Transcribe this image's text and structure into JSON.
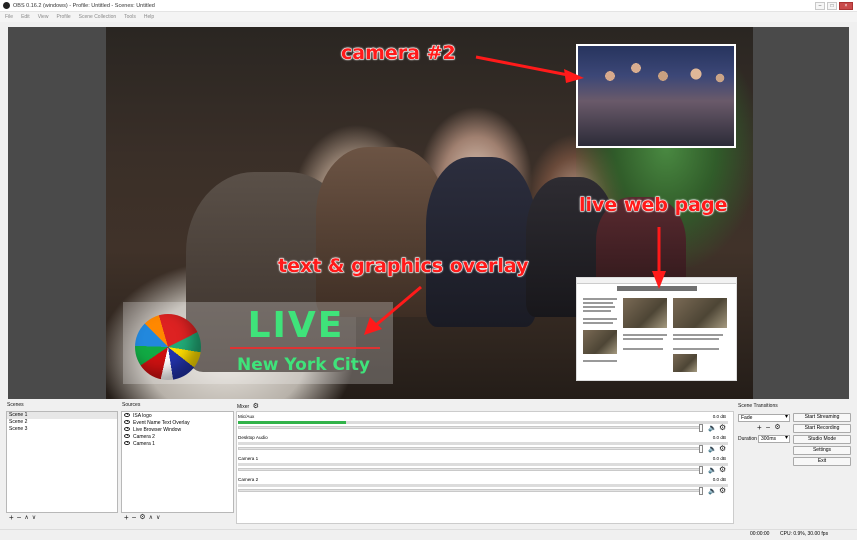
{
  "window": {
    "title": "OBS 0.16.2 (windows) - Profile: Untitled - Scenes: Untitled",
    "min_icon": "minimize-icon",
    "max_icon": "maximize-icon",
    "close_icon": "close-icon"
  },
  "menu": [
    "File",
    "Edit",
    "View",
    "Profile",
    "Scene Collection",
    "Tools",
    "Help"
  ],
  "preview": {
    "annotations": {
      "camera2": "camera #2",
      "webpage": "live web page",
      "overlay": "text & graphics overlay"
    },
    "overlay_live": "LIVE",
    "overlay_city": "New York City",
    "annotation_color": "#ff1a1a",
    "overlay_text_color": "#3fe37a"
  },
  "scenes": {
    "label": "Scenes",
    "items": [
      "Scene 1",
      "Scene 2",
      "Scene 3"
    ],
    "selected": "Scene 1"
  },
  "sources": {
    "label": "Sources",
    "items": [
      "ISA logo",
      "Event Name Text Overlay",
      "Live Browser Window",
      "Camera 2",
      "Camera 1"
    ]
  },
  "mixer": {
    "label": "Mixer",
    "tracks": [
      {
        "name": "Mic/Aux",
        "db": "0.0 dB",
        "level": 0.22
      },
      {
        "name": "Desktop Audio",
        "db": "0.0 dB",
        "level": 0
      },
      {
        "name": "Camera 1",
        "db": "0.0 dB",
        "level": 0
      },
      {
        "name": "Camera 2",
        "db": "0.0 dB",
        "level": 0
      }
    ]
  },
  "transitions": {
    "label": "Scene Transitions",
    "selected": "Fade",
    "duration_label": "Duration",
    "duration_value": "300ms"
  },
  "controls": {
    "start_streaming": "Start Streaming",
    "start_recording": "Start Recording",
    "studio_mode": "Studio Mode",
    "settings": "Settings",
    "exit": "Exit"
  },
  "status": {
    "time": "00:00:00",
    "cpu": "CPU: 0.9%, 30.00 fps"
  }
}
